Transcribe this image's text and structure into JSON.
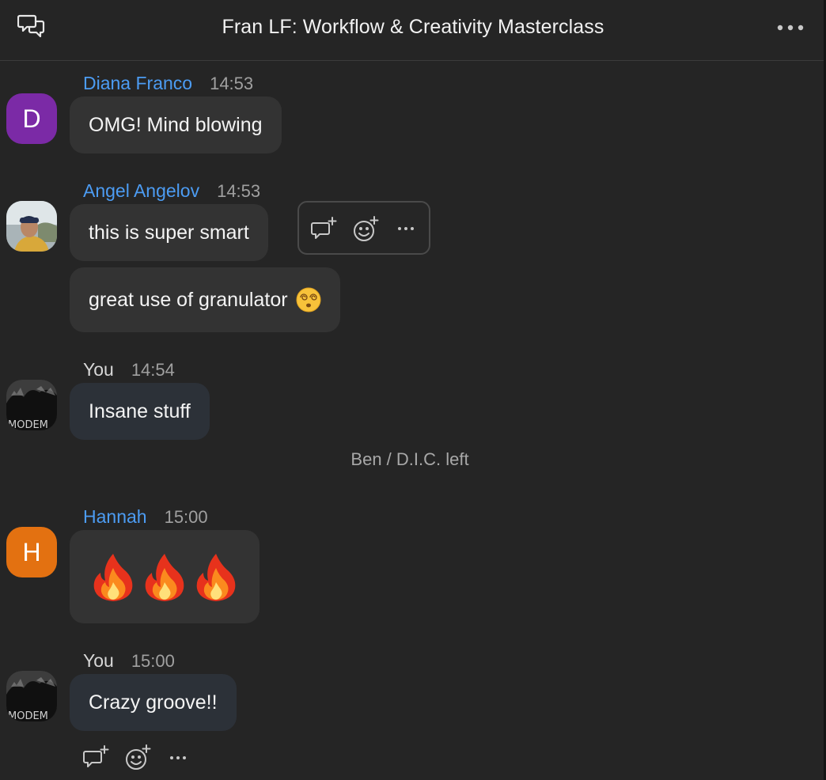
{
  "header": {
    "title": "Fran LF: Workflow & Creativity Masterclass"
  },
  "messages": [
    {
      "sender": "Diana Franco",
      "time": "14:53",
      "avatar_letter": "D",
      "avatar_color": "#7b2aa6",
      "texts": [
        "OMG! Mind blowing"
      ]
    },
    {
      "sender": "Angel Angelov",
      "time": "14:53",
      "texts": [
        "this is super smart",
        "great use of granulator"
      ]
    },
    {
      "sender": "You",
      "time": "14:54",
      "avatar_caption": "MODEM",
      "texts": [
        "Insane stuff"
      ]
    },
    {
      "sender": "Hannah",
      "time": "15:00",
      "avatar_letter": "H",
      "avatar_color": "#e37111",
      "reactions": "fire-emoji x3"
    },
    {
      "sender": "You",
      "time": "15:00",
      "avatar_caption": "MODEM",
      "texts": [
        "Crazy groove!!"
      ]
    }
  ],
  "system_notice": "Ben / D.I.C. left",
  "colors": {
    "background": "#252525",
    "bubble": "#333333",
    "own_bubble": "#2c3138",
    "name_link": "#4c9cf3",
    "timestamp": "#a0a0a0"
  },
  "icons": [
    "chat-bubbles-icon",
    "more-horizontal-icon",
    "reply-in-thread-icon",
    "add-reaction-icon",
    "more-actions-icon",
    "dizzy-face-emoji",
    "fire-emoji"
  ]
}
